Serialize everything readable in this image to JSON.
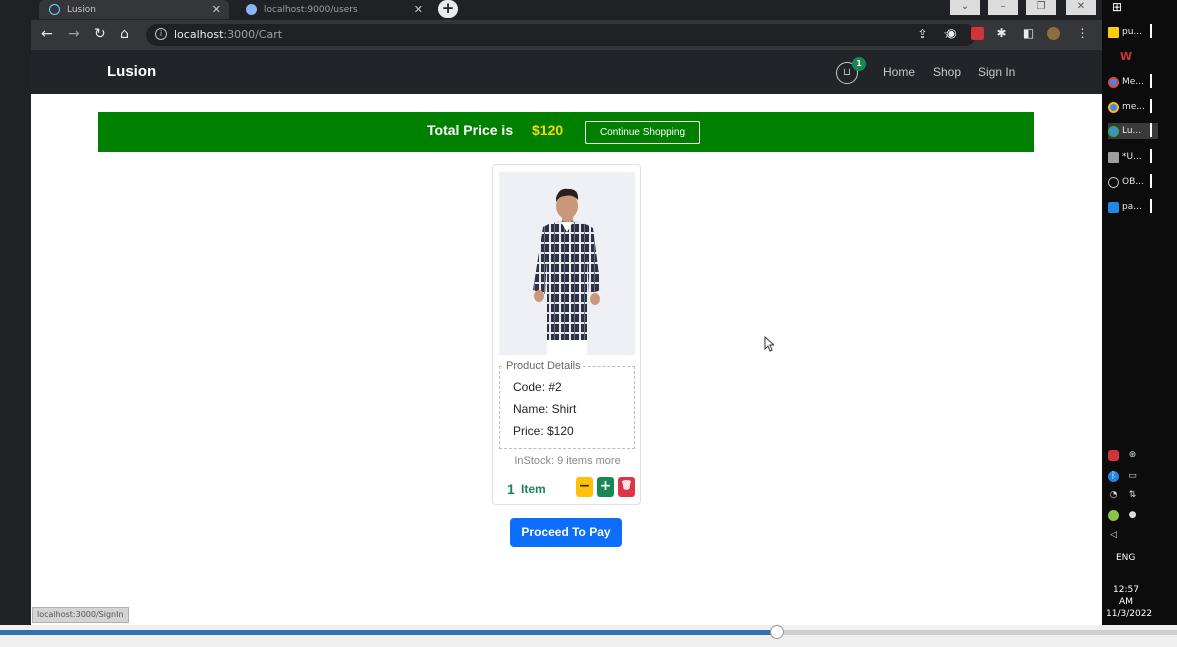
{
  "browser": {
    "tabs": [
      {
        "title": "Lusion",
        "favicon_color": "#61dafb",
        "active": true
      },
      {
        "title": "localhost:9000/users",
        "favicon_color": "#8ab4f8",
        "active": false
      }
    ],
    "new_tab_symbol": "+",
    "url_host": "localhost",
    "url_path": ":3000/Cart",
    "status_url": "localhost:3000/SignIn"
  },
  "navbar": {
    "brand": "Lusion",
    "cart_count": "1",
    "links": [
      "Home",
      "Shop",
      "Sign In"
    ]
  },
  "cart": {
    "total_label": "Total Price is",
    "total_amount": "$120",
    "continue_label": "Continue Shopping",
    "item": {
      "details_legend": "Product Details",
      "code": "Code: #2",
      "name": "Name: Shirt",
      "price": "Price: $120",
      "instock": "InStock: 9 items more",
      "quantity": "1",
      "quantity_unit": "Item"
    },
    "pay_label": "Proceed To Pay"
  },
  "taskbar": {
    "items": [
      {
        "label": "pu...",
        "color": "#ffcc00"
      },
      {
        "label": "",
        "color": "#d13438"
      },
      {
        "label": "Me...",
        "color": "#4285f4"
      },
      {
        "label": "me...",
        "color": "#4285f4"
      },
      {
        "label": "Lu...",
        "color": "#4285f4"
      },
      {
        "label": "*U...",
        "color": "#9e9e9e"
      },
      {
        "label": "OB...",
        "color": "#9e9e9e"
      },
      {
        "label": "pa...",
        "color": "#1e88e5"
      }
    ],
    "language": "ENG",
    "time": "12:57 AM",
    "date": "11/3/2022"
  },
  "colors": {
    "banner_green": "#008000",
    "price_gold": "#ffd700",
    "pay_blue": "#0d6efd",
    "qty_green": "#198754"
  },
  "video_progress": 0.66
}
